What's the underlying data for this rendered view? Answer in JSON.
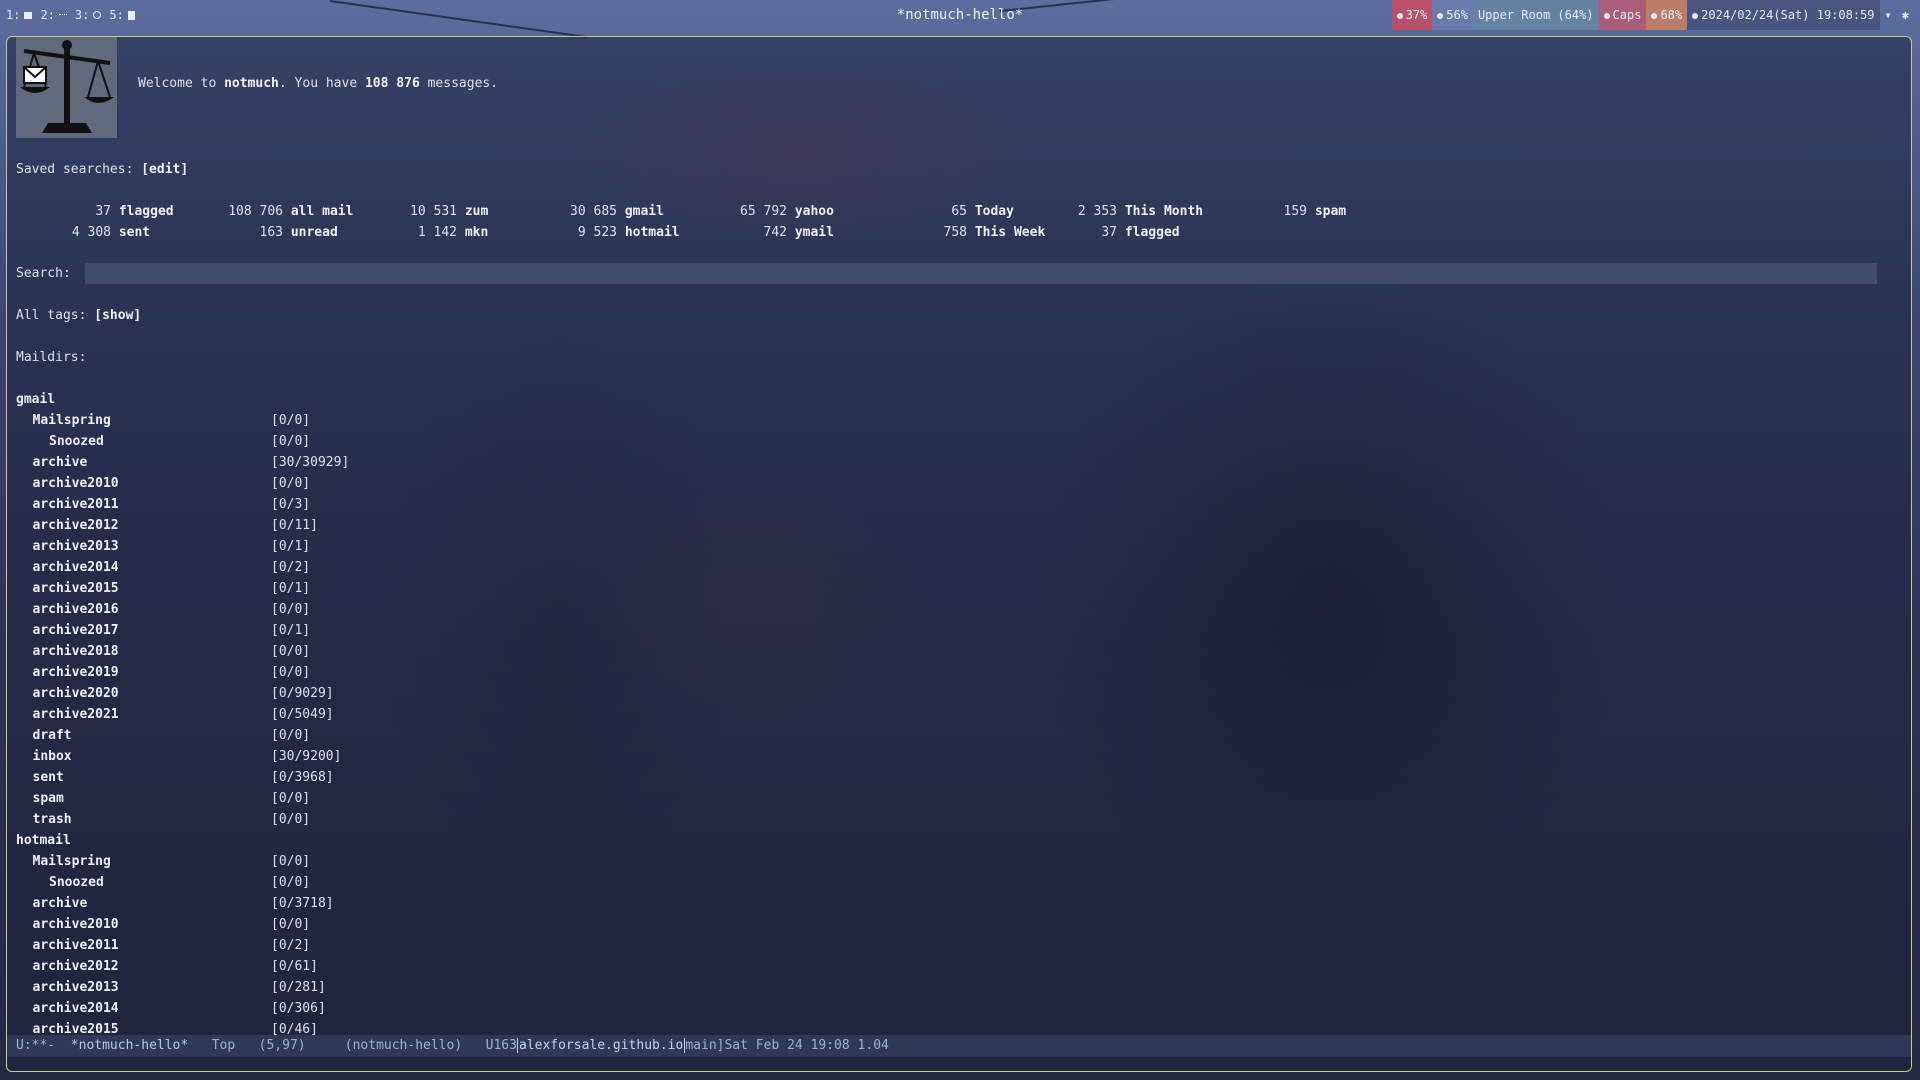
{
  "topbar": {
    "workspaces": [
      {
        "label": "1:",
        "icon": "mail-icon"
      },
      {
        "label": "2:",
        "icon": "dots-icon"
      },
      {
        "label": "3:",
        "icon": "ring-icon"
      },
      {
        "label": "5:",
        "icon": "document-icon"
      }
    ],
    "title": "*notmuch-hello*",
    "status": {
      "cpu": "37%",
      "volume": "56%",
      "network": "Upper Room (64%)",
      "caps": "Caps",
      "battery": "68%",
      "datetime": "2024/02/24(Sat) 19:08:59"
    }
  },
  "welcome": {
    "prefix": "Welcome to ",
    "app": "notmuch",
    "mid": ". You have ",
    "count": "108 876",
    "suffix": " messages."
  },
  "saved_searches": {
    "label": "Saved searches: ",
    "edit": "[edit]",
    "items": [
      {
        "count": "37",
        "name": "flagged"
      },
      {
        "count": "108 706",
        "name": "all mail"
      },
      {
        "count": "10 531",
        "name": "zum"
      },
      {
        "count": "30 685",
        "name": "gmail"
      },
      {
        "count": "65 792",
        "name": "yahoo"
      },
      {
        "count": "65",
        "name": "Today"
      },
      {
        "count": "2 353",
        "name": "This Month"
      },
      {
        "count": "159",
        "name": "spam"
      },
      {
        "count": "4 308",
        "name": "sent"
      },
      {
        "count": "163",
        "name": "unread"
      },
      {
        "count": "1 142",
        "name": "mkn"
      },
      {
        "count": "9 523",
        "name": "hotmail"
      },
      {
        "count": "742",
        "name": "ymail"
      },
      {
        "count": "758",
        "name": "This Week"
      },
      {
        "count": "37",
        "name": "flagged"
      }
    ]
  },
  "search": {
    "label": "Search: ",
    "value": ""
  },
  "tags": {
    "label": "All tags: ",
    "show": "[show]"
  },
  "maildirs": {
    "label": "Maildirs:",
    "rows": [
      {
        "name": "gmail",
        "count": "",
        "depth": 0
      },
      {
        "name": "Mailspring",
        "count": "[0/0]",
        "depth": 1
      },
      {
        "name": "Snoozed",
        "count": "[0/0]",
        "depth": 2
      },
      {
        "name": "archive",
        "count": "[30/30929]",
        "depth": 1
      },
      {
        "name": "archive2010",
        "count": "[0/0]",
        "depth": 1
      },
      {
        "name": "archive2011",
        "count": "[0/3]",
        "depth": 1
      },
      {
        "name": "archive2012",
        "count": "[0/11]",
        "depth": 1
      },
      {
        "name": "archive2013",
        "count": "[0/1]",
        "depth": 1
      },
      {
        "name": "archive2014",
        "count": "[0/2]",
        "depth": 1
      },
      {
        "name": "archive2015",
        "count": "[0/1]",
        "depth": 1
      },
      {
        "name": "archive2016",
        "count": "[0/0]",
        "depth": 1
      },
      {
        "name": "archive2017",
        "count": "[0/1]",
        "depth": 1
      },
      {
        "name": "archive2018",
        "count": "[0/0]",
        "depth": 1
      },
      {
        "name": "archive2019",
        "count": "[0/0]",
        "depth": 1
      },
      {
        "name": "archive2020",
        "count": "[0/9029]",
        "depth": 1
      },
      {
        "name": "archive2021",
        "count": "[0/5049]",
        "depth": 1
      },
      {
        "name": "draft",
        "count": "[0/0]",
        "depth": 1
      },
      {
        "name": "inbox",
        "count": "[30/9200]",
        "depth": 1
      },
      {
        "name": "sent",
        "count": "[0/3968]",
        "depth": 1
      },
      {
        "name": "spam",
        "count": "[0/0]",
        "depth": 1
      },
      {
        "name": "trash",
        "count": "[0/0]",
        "depth": 1
      },
      {
        "name": "hotmail",
        "count": "",
        "depth": 0
      },
      {
        "name": "Mailspring",
        "count": "[0/0]",
        "depth": 1
      },
      {
        "name": "Snoozed",
        "count": "[0/0]",
        "depth": 2
      },
      {
        "name": "archive",
        "count": "[0/3718]",
        "depth": 1
      },
      {
        "name": "archive2010",
        "count": "[0/0]",
        "depth": 1
      },
      {
        "name": "archive2011",
        "count": "[0/2]",
        "depth": 1
      },
      {
        "name": "archive2012",
        "count": "[0/61]",
        "depth": 1
      },
      {
        "name": "archive2013",
        "count": "[0/281]",
        "depth": 1
      },
      {
        "name": "archive2014",
        "count": "[0/306]",
        "depth": 1
      },
      {
        "name": "archive2015",
        "count": "[0/46]",
        "depth": 1
      }
    ]
  },
  "modeline": {
    "state": "U:**-",
    "buffer": "*notmuch-hello*",
    "position": "Top",
    "cursor": "(5,97)",
    "mode": "(notmuch-hello)",
    "vc_prefix": "U163",
    "repo": "alexforsale.github.io",
    "branch": "main",
    "time": "Sat Feb 24 19:08 1.04"
  }
}
